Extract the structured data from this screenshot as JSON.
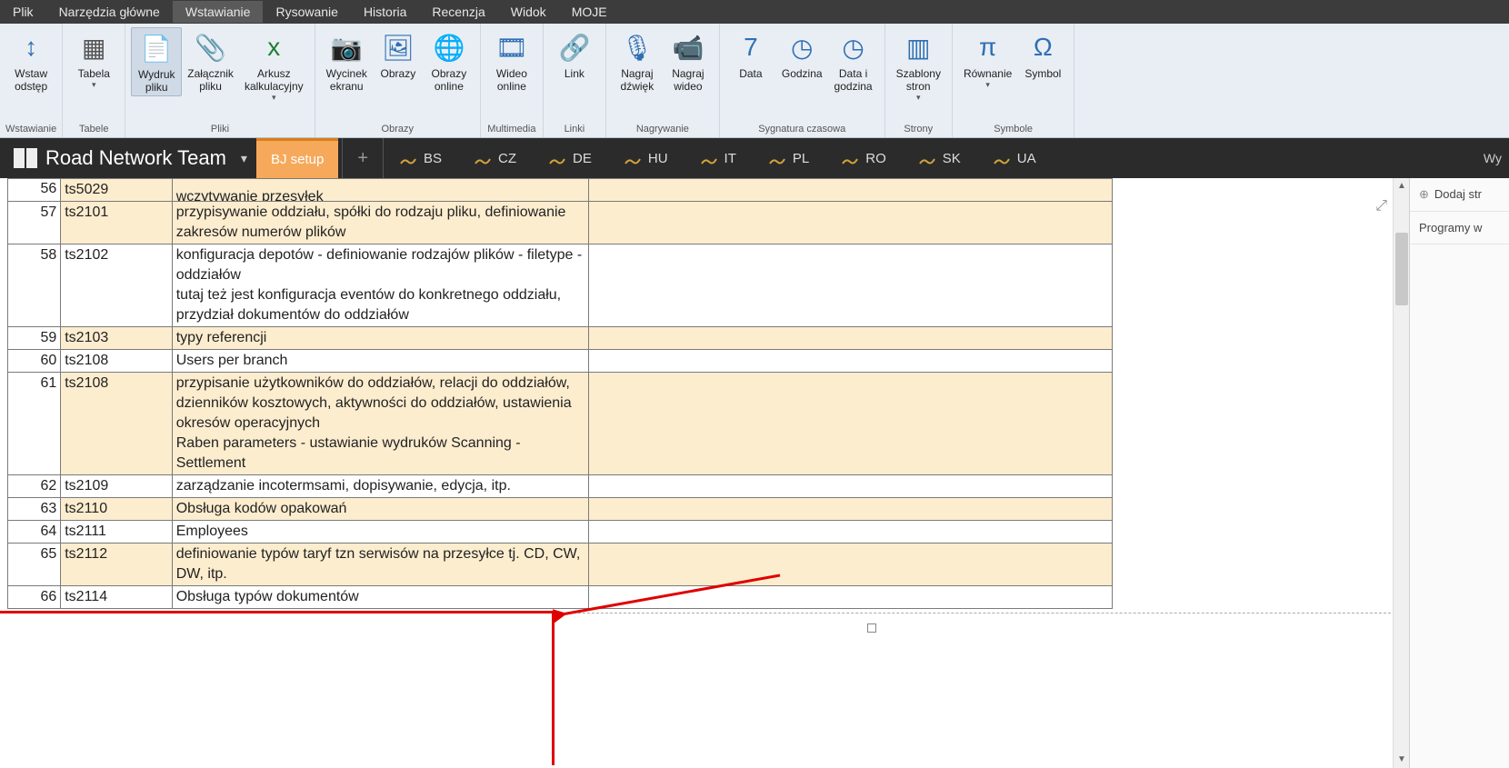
{
  "menu": {
    "items": [
      "Plik",
      "Narzędzia główne",
      "Wstawianie",
      "Rysowanie",
      "Historia",
      "Recenzja",
      "Widok",
      "MOJE"
    ],
    "active_index": 2
  },
  "ribbon": {
    "groups": [
      {
        "label": "Wstawianie",
        "buttons": [
          {
            "name": "wstaw-odstep",
            "text": "Wstaw\nodstęp",
            "icon": "↕",
            "color": "#2f6fb3"
          }
        ]
      },
      {
        "label": "Tabele",
        "buttons": [
          {
            "name": "tabela",
            "text": "Tabela",
            "icon": "▦",
            "color": "#555",
            "dd": true
          }
        ]
      },
      {
        "label": "Pliki",
        "buttons": [
          {
            "name": "wydruk-pliku",
            "text": "Wydruk\npliku",
            "icon": "📄",
            "sel": true
          },
          {
            "name": "zalacznik-pliku",
            "text": "Załącznik\npliku",
            "icon": "📎",
            "color": "#777"
          },
          {
            "name": "arkusz-kalkulacyjny",
            "text": "Arkusz\nkalkulacyjny",
            "icon": "x",
            "color": "#1e7e34",
            "dd": true
          }
        ]
      },
      {
        "label": "Obrazy",
        "buttons": [
          {
            "name": "wycinek-ekranu",
            "text": "Wycinek\nekranu",
            "icon": "📷",
            "color": "#333"
          },
          {
            "name": "obrazy",
            "text": "Obrazy",
            "icon": "🖼",
            "color": "#2f6fb3"
          },
          {
            "name": "obrazy-online",
            "text": "Obrazy\nonline",
            "icon": "🌐",
            "color": "#2f6fb3"
          }
        ]
      },
      {
        "label": "Multimedia",
        "buttons": [
          {
            "name": "wideo-online",
            "text": "Wideo\nonline",
            "icon": "🎞",
            "color": "#2f6fb3"
          }
        ]
      },
      {
        "label": "Linki",
        "buttons": [
          {
            "name": "link",
            "text": "Link",
            "icon": "🔗",
            "color": "#2f6fb3"
          }
        ]
      },
      {
        "label": "Nagrywanie",
        "buttons": [
          {
            "name": "nagraj-dzwiek",
            "text": "Nagraj\ndźwięk",
            "icon": "🎙",
            "color": "#2f6fb3"
          },
          {
            "name": "nagraj-wideo",
            "text": "Nagraj\nwideo",
            "icon": "📹",
            "color": "#2f6fb3"
          }
        ]
      },
      {
        "label": "Sygnatura czasowa",
        "buttons": [
          {
            "name": "data",
            "text": "Data",
            "icon": "7",
            "color": "#2f6fb3"
          },
          {
            "name": "godzina",
            "text": "Godzina",
            "icon": "◷",
            "color": "#2f6fb3"
          },
          {
            "name": "data-godzina",
            "text": "Data i\ngodzina",
            "icon": "◷",
            "color": "#2f6fb3"
          }
        ]
      },
      {
        "label": "Strony",
        "buttons": [
          {
            "name": "szablony-stron",
            "text": "Szablony\nstron",
            "icon": "▥",
            "color": "#2f6fb3",
            "dd": true
          }
        ]
      },
      {
        "label": "Symbole",
        "buttons": [
          {
            "name": "rownanie",
            "text": "Równanie",
            "icon": "π",
            "color": "#2f6fb3",
            "dd": true
          },
          {
            "name": "symbol",
            "text": "Symbol",
            "icon": "Ω",
            "color": "#2f6fb3"
          }
        ]
      }
    ]
  },
  "notebook": {
    "title": "Road Network Team",
    "active_tab": "BJ setup",
    "sections": [
      "BS",
      "CZ",
      "DE",
      "HU",
      "IT",
      "PL",
      "RO",
      "SK",
      "UA"
    ],
    "right_btn": "Wy"
  },
  "right_panel": {
    "add": "Dodaj str",
    "items": [
      "Programy w"
    ]
  },
  "table": {
    "rows": [
      {
        "n": "56",
        "code": "ts5029",
        "desc": "wczytywanie przesyłek",
        "white": false,
        "cut": true
      },
      {
        "n": "57",
        "code": "ts2101",
        "desc": "przypisywanie oddziału, spółki do rodzaju pliku, definiowanie zakresów numerów plików",
        "white": false
      },
      {
        "n": "58",
        "code": "ts2102",
        "desc": "konfiguracja depotów - definiowanie rodzajów plików - filetype - oddziałów\ntutaj też jest konfiguracja eventów do konkretnego oddziału, przydział dokumentów do oddziałów",
        "white": true
      },
      {
        "n": "59",
        "code": "ts2103",
        "desc": "typy referencji",
        "white": false
      },
      {
        "n": "60",
        "code": "ts2108",
        "desc": "Users per branch",
        "white": true
      },
      {
        "n": "61",
        "code": "ts2108",
        "desc": "przypisanie użytkowników do oddziałów, relacji do oddziałów, dzienników kosztowych, aktywności do oddziałów, ustawienia okresów operacyjnych\nRaben parameters - ustawianie wydruków Scanning - Settlement",
        "white": false
      },
      {
        "n": "62",
        "code": "ts2109",
        "desc": "zarządzanie incotermsami, dopisywanie, edycja, itp.",
        "white": true
      },
      {
        "n": "63",
        "code": "ts2110",
        "desc": "Obsługa kodów opakowań",
        "white": false
      },
      {
        "n": "64",
        "code": "ts2111",
        "desc": "Employees",
        "white": true
      },
      {
        "n": "65",
        "code": "ts2112",
        "desc": "definiowanie typów taryf tzn serwisów na przesyłce tj. CD, CW, DW, itp.",
        "white": false
      },
      {
        "n": "66",
        "code": "ts2114",
        "desc": "Obsługa typów dokumentów",
        "white": true
      }
    ]
  }
}
